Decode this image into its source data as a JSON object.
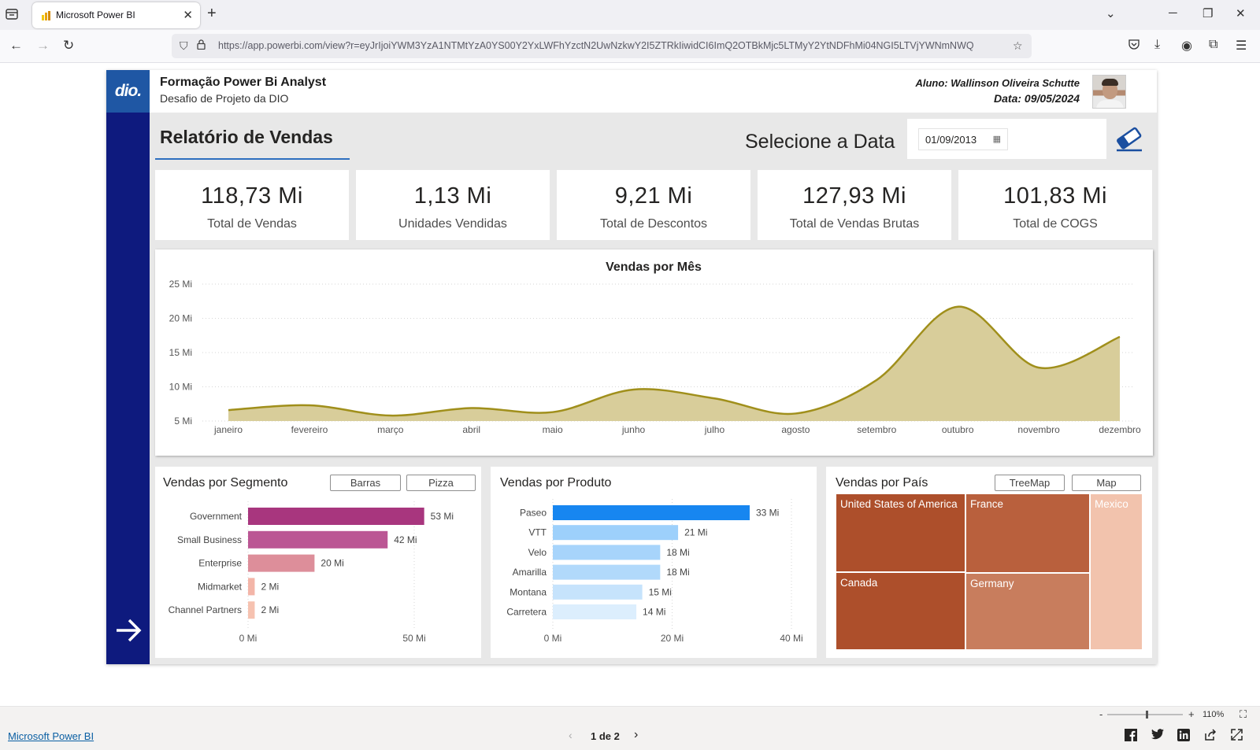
{
  "browser": {
    "tab_title": "Microsoft Power BI",
    "url_host": "https://app.powerbi.com/view?r=eyJrIjoiYWM3YzA1NTMtYzA0YS00Y2YxLWFhYzctN2UwNzkwY2I5ZTRkIiwidCI6ImQ2OTBkMjc5LTMyY2YtNDFhMi04NGI5LTVjYWNmNWQ"
  },
  "report": {
    "course_title": "Formação Power Bi Analyst",
    "course_subtitle": "Desafio de Projeto da DIO",
    "logo_text": "dio.",
    "student": "Aluno: Wallinson Oliveira Schutte",
    "date": "Data: 09/05/2024",
    "title": "Relatório de Vendas",
    "select_date_label": "Selecione a Data",
    "date_value": "01/09/2013"
  },
  "kpis": [
    {
      "value": "118,73 Mi",
      "label": "Total de Vendas"
    },
    {
      "value": "1,13 Mi",
      "label": "Unidades Vendidas"
    },
    {
      "value": "9,21 Mi",
      "label": "Total de Descontos"
    },
    {
      "value": "127,93 Mi",
      "label": "Total de Vendas Brutas"
    },
    {
      "value": "101,83 Mi",
      "label": "Total de COGS"
    }
  ],
  "segment_panel": {
    "title": "Vendas por Segmento",
    "btn_bars": "Barras",
    "btn_pie": "Pizza"
  },
  "product_panel": {
    "title": "Vendas por Produto"
  },
  "country_panel": {
    "title": "Vendas por País",
    "btn_treemap": "TreeMap",
    "btn_map": "Map"
  },
  "chart_data": [
    {
      "type": "area",
      "title": "Vendas por Mês",
      "categories": [
        "janeiro",
        "fevereiro",
        "março",
        "abril",
        "maio",
        "junho",
        "julho",
        "agosto",
        "setembro",
        "outubro",
        "novembro",
        "dezembro"
      ],
      "values": [
        6.6,
        7.3,
        5.8,
        6.9,
        6.3,
        9.6,
        8.3,
        6.1,
        11.0,
        21.7,
        12.8,
        17.3
      ],
      "y_ticks": [
        "25 Mi",
        "20 Mi",
        "15 Mi",
        "10 Mi",
        "5 Mi"
      ],
      "ylim": [
        5,
        25
      ],
      "color": "#a08f1b",
      "fill": "#d8cd9a",
      "grid": true
    },
    {
      "type": "bar",
      "title": "Vendas por Segmento",
      "categories": [
        "Government",
        "Small Business",
        "Enterprise",
        "Midmarket",
        "Channel Partners"
      ],
      "values": [
        53,
        42,
        20,
        2,
        2
      ],
      "labels": [
        "53 Mi",
        "42 Mi",
        "20 Mi",
        "2 Mi",
        "2 Mi"
      ],
      "x_ticks": [
        "0 Mi",
        "50 Mi"
      ],
      "xlim": [
        0,
        50
      ],
      "colors": [
        "#a8367e",
        "#bb5694",
        "#dd8e9a",
        "#f3b5a8",
        "#f6c2b0"
      ]
    },
    {
      "type": "bar",
      "title": "Vendas por Produto",
      "categories": [
        "Paseo",
        "VTT",
        "Velo",
        "Amarilla",
        "Montana",
        "Carretera"
      ],
      "values": [
        33,
        21,
        18,
        18,
        15,
        14
      ],
      "labels": [
        "33 Mi",
        "21 Mi",
        "18 Mi",
        "18 Mi",
        "15 Mi",
        "14 Mi"
      ],
      "x_ticks": [
        "0 Mi",
        "20 Mi",
        "40 Mi"
      ],
      "xlim": [
        0,
        40
      ],
      "colors": [
        "#1786f0",
        "#9dd0fb",
        "#a7d4fb",
        "#b1d9fb",
        "#c6e3fc",
        "#dceefd"
      ]
    },
    {
      "type": "treemap",
      "title": "Vendas por País",
      "categories": [
        "United States of America",
        "Canada",
        "France",
        "Germany",
        "Mexico"
      ],
      "colors": [
        "#ad4f2b",
        "#ad4f2b",
        "#b9603d",
        "#c87d5d",
        "#f2c3ad"
      ]
    }
  ],
  "footer": {
    "link": "Microsoft Power BI",
    "pager": "1 de 2",
    "zoom": "110%"
  }
}
